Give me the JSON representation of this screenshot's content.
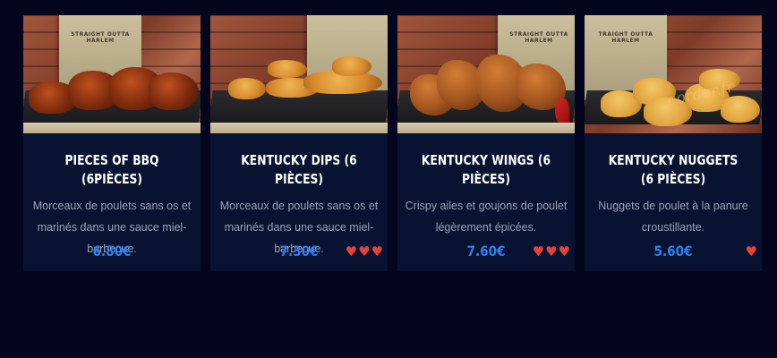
{
  "page": {
    "background": "#03061c",
    "accent_price": "#2d7ff2",
    "heart_color": "#e8403a"
  },
  "products": [
    {
      "title": "PIECES OF BBQ (6PIÈCES)",
      "description": "Morceaux de poulets sans os et marinés dans une sauce miel-barbecue.",
      "price": "6.80€",
      "spice_hearts": 0,
      "bag_label": "STRAIGHT OUTTA HARLEM",
      "image_subject": "bbq-chicken-pieces"
    },
    {
      "title": "KENTUCKY DIPS (6 PIÈCES)",
      "description": "Morceaux de poulets sans os et marinés dans une sauce miel-barbecue.",
      "price": "7.30€",
      "spice_hearts": 3,
      "bag_label": "",
      "image_subject": "kentucky-dips"
    },
    {
      "title": "KENTUCKY WINGS (6 PIÈCES)",
      "description": "Crispy ailes et goujons de poulet légèrement épicées.",
      "price": "7.60€",
      "spice_hearts": 3,
      "bag_label": "STRAIGHT OUTTA HARLEM",
      "image_subject": "kentucky-wings"
    },
    {
      "title": "KENTUCKY NUGGETS (6 PIÈCES)",
      "description": "Nuggets de poulet à la panure croustillante.",
      "price": "5.60€",
      "spice_hearts": 1,
      "bag_label": "TRAIGHT OUTTA HARLEM",
      "watermark": "eorder.fr",
      "image_subject": "kentucky-nuggets"
    }
  ],
  "icons": {
    "heart": "heart-icon"
  }
}
